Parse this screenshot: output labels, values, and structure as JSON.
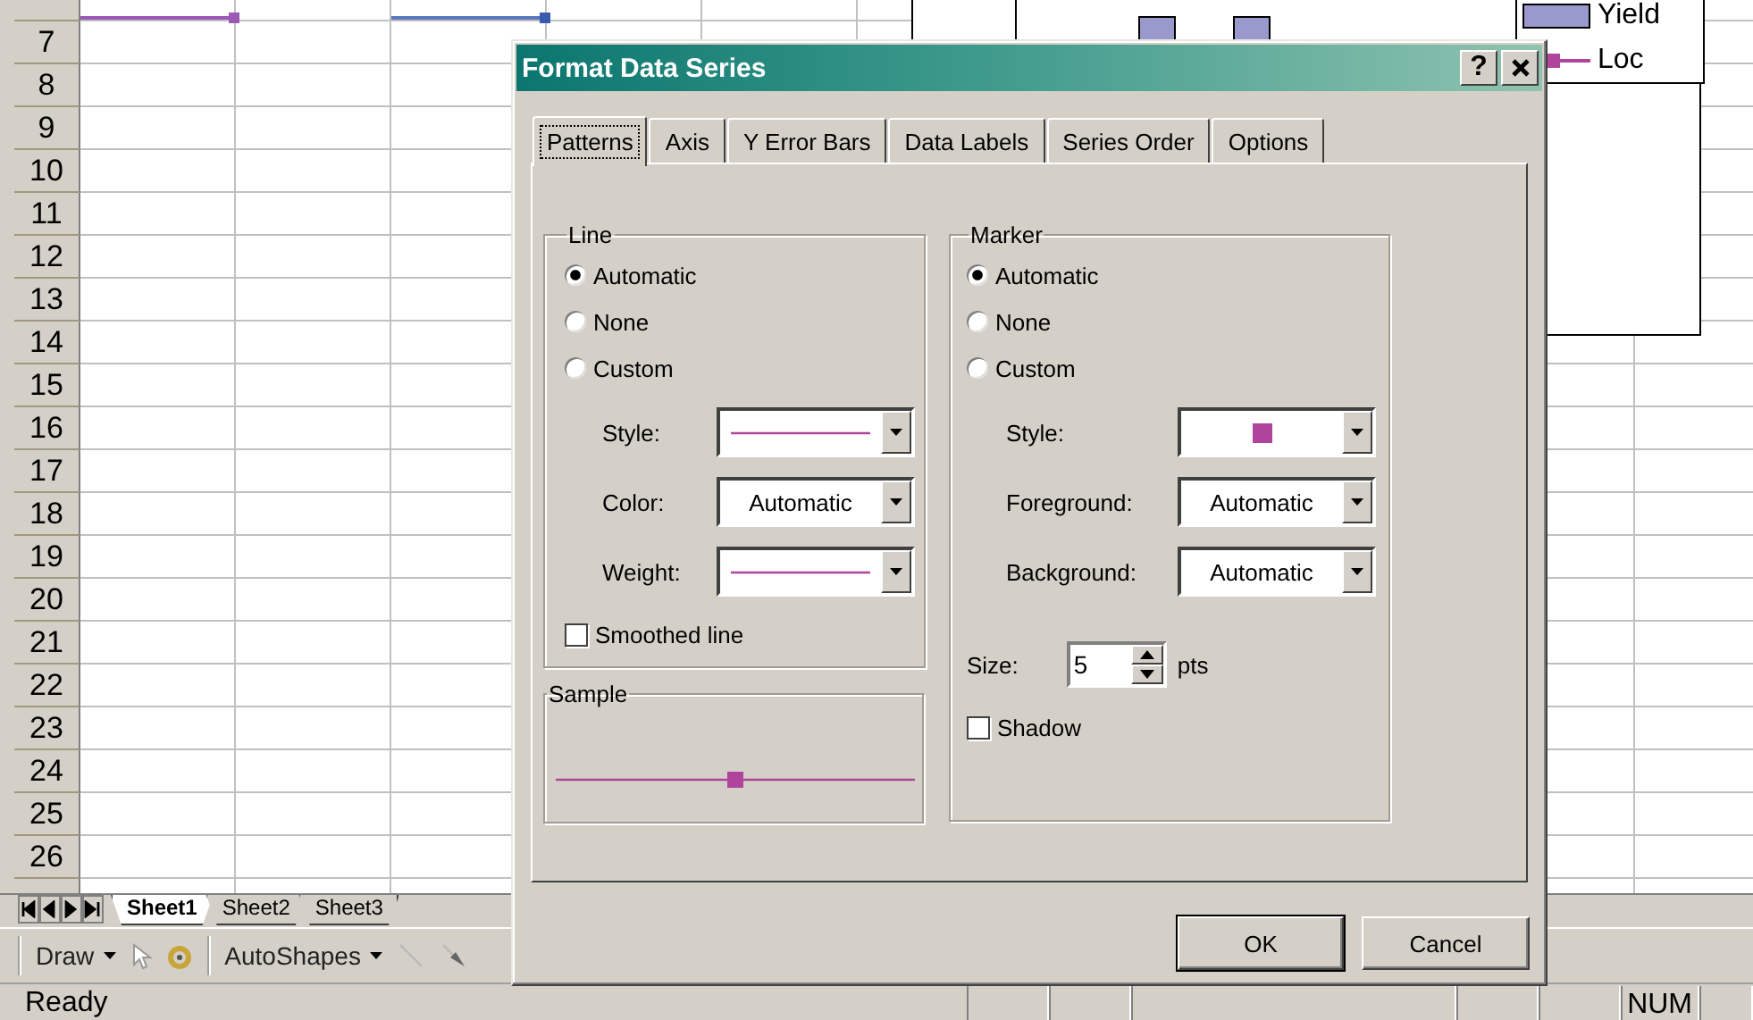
{
  "sheet": {
    "row_headers": [
      "7",
      "8",
      "9",
      "10",
      "11",
      "12",
      "13",
      "14",
      "15",
      "16",
      "17",
      "18",
      "19",
      "20",
      "21",
      "22",
      "23",
      "24",
      "25",
      "26"
    ],
    "tabs": [
      {
        "label": "Sheet1",
        "selected": true
      },
      {
        "label": "Sheet2",
        "selected": false
      },
      {
        "label": "Sheet3",
        "selected": false
      }
    ]
  },
  "chart": {
    "legend": [
      {
        "label": "Yield",
        "kind": "bar",
        "color": "#9999cc"
      },
      {
        "label": "Loc",
        "kind": "line",
        "color": "#b0449c"
      }
    ]
  },
  "draw_toolbar": {
    "draw": "Draw",
    "autoshapes": "AutoShapes"
  },
  "status_bar": {
    "status": "Ready",
    "indicators": [
      "NUM"
    ]
  },
  "dialog": {
    "title": "Format Data Series",
    "help": "?",
    "tabs": [
      {
        "label": "Patterns",
        "selected": true
      },
      {
        "label": "Axis",
        "selected": false
      },
      {
        "label": "Y Error Bars",
        "selected": false
      },
      {
        "label": "Data Labels",
        "selected": false
      },
      {
        "label": "Series Order",
        "selected": false
      },
      {
        "label": "Options",
        "selected": false
      }
    ],
    "line": {
      "title": "Line",
      "options": [
        {
          "label": "Automatic",
          "selected": true
        },
        {
          "label": "None",
          "selected": false
        },
        {
          "label": "Custom",
          "selected": false
        }
      ],
      "fields": [
        {
          "label": "Style:",
          "kind": "line"
        },
        {
          "label": "Color:",
          "kind": "text",
          "value": "Automatic"
        },
        {
          "label": "Weight:",
          "kind": "line"
        }
      ],
      "smoothed": {
        "label": "Smoothed line",
        "checked": false
      }
    },
    "sample": {
      "title": "Sample"
    },
    "marker": {
      "title": "Marker",
      "options": [
        {
          "label": "Automatic",
          "selected": true
        },
        {
          "label": "None",
          "selected": false
        },
        {
          "label": "Custom",
          "selected": false
        }
      ],
      "fields": [
        {
          "label": "Style:",
          "kind": "marker"
        },
        {
          "label": "Foreground:",
          "kind": "text",
          "value": "Automatic"
        },
        {
          "label": "Background:",
          "kind": "text",
          "value": "Automatic"
        }
      ],
      "size": {
        "label": "Size:",
        "value": "5",
        "unit": "pts"
      },
      "shadow": {
        "label": "Shadow",
        "checked": false
      }
    },
    "buttons": [
      {
        "label": "OK",
        "default": true
      },
      {
        "label": "Cancel",
        "default": false
      }
    ]
  }
}
